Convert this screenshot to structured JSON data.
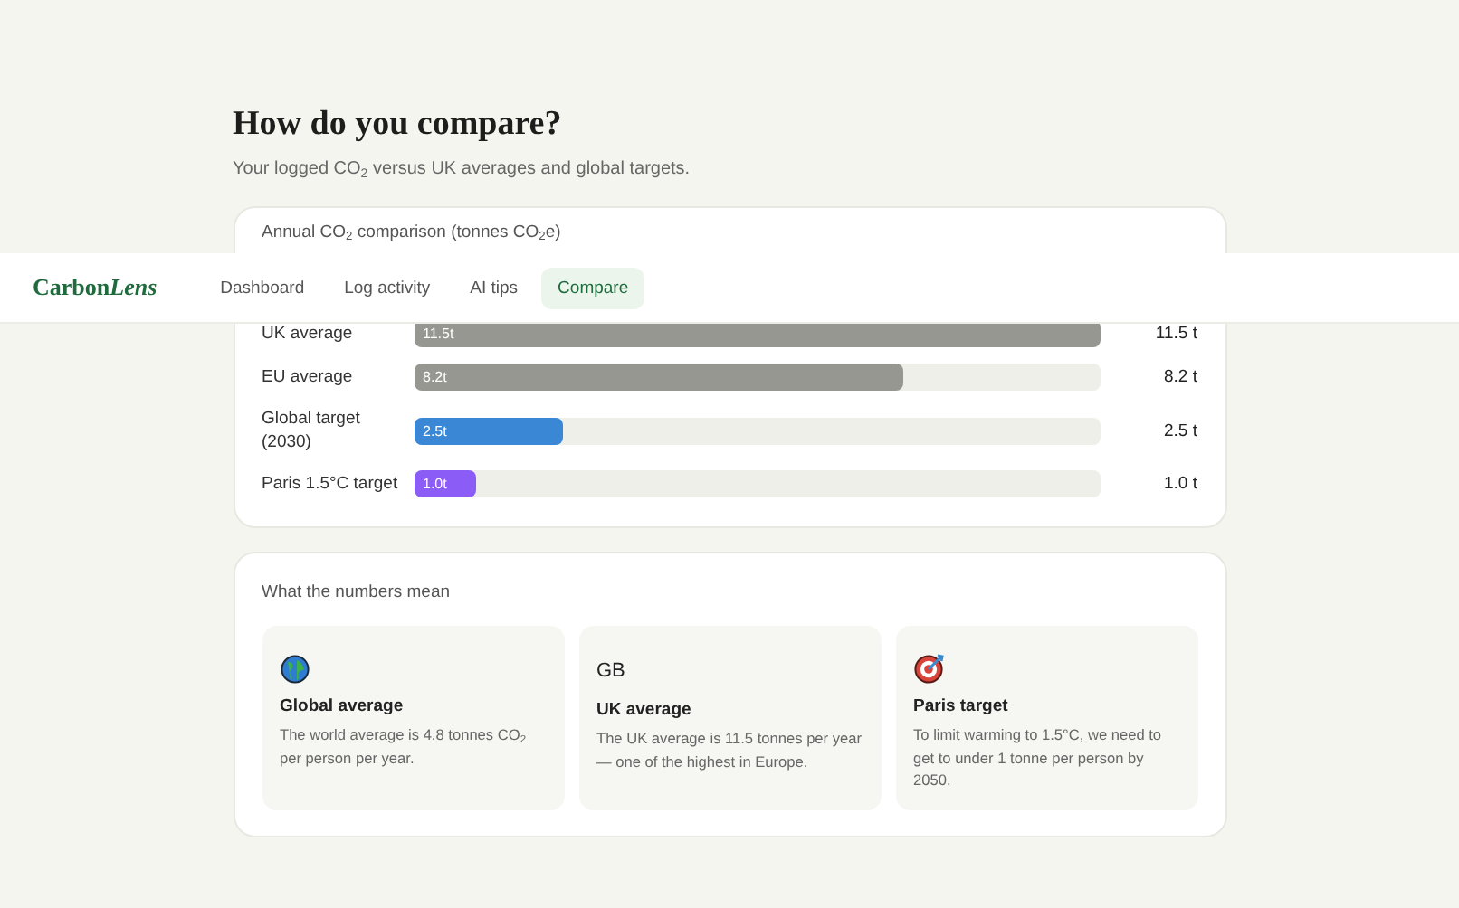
{
  "nav": {
    "logo": {
      "plain": "Carbon",
      "italic": "Lens"
    },
    "items": [
      {
        "label": "Dashboard",
        "selected": false
      },
      {
        "label": "Log activity",
        "selected": false
      },
      {
        "label": "AI tips",
        "selected": false
      },
      {
        "label": "Compare",
        "selected": true
      }
    ]
  },
  "heading": "How do you compare?",
  "subtitle": "Your logged CO$_{2}$ versus UK averages and global targets.",
  "comparison": {
    "title": "Annual CO$_{2}$ comparison (tonnes CO$_{2}$e)",
    "rows": [
      {
        "label": "UK average",
        "bar_label": "11.5t",
        "value": "11.5 t",
        "level": 1.0,
        "color": "#979792"
      },
      {
        "label": "EU average",
        "bar_label": "8.2t",
        "value": "8.2 t",
        "level": 0.713,
        "color": "#979792"
      },
      {
        "label": "Global target (2030)",
        "bar_label": "2.5t",
        "value": "2.5 t",
        "level": 0.217,
        "color": "#3a87d6"
      },
      {
        "label": "Paris 1.5°C target",
        "bar_label": "1.0t",
        "value": "1.0 t",
        "level": 0.09,
        "color": "#8b5cf6"
      }
    ]
  },
  "explainer": {
    "title": "What the numbers mean",
    "cards": [
      {
        "kind": "globe",
        "title": "Global average",
        "text": "The world average is 4.8 tonnes CO$_{2}$ per person per year."
      },
      {
        "kind": "text",
        "badge": "GB",
        "title": "UK average",
        "text": "The UK average is 11.5 tonnes per year — one of the highest in Europe."
      },
      {
        "kind": "target",
        "title": "Paris target",
        "text": "To limit warming to 1.5°C, we need to get to under 1 tonne per person by 2050."
      }
    ]
  }
}
